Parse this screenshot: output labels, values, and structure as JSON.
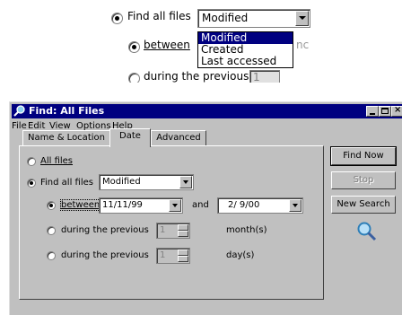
{
  "inset": {
    "find_all_files_label": "Find all files",
    "combo_value": "Modified",
    "options": [
      "Modified",
      "Created",
      "Last accessed"
    ],
    "between_label": "between",
    "between_trailing": "nc",
    "during_label": "during the previous",
    "during_value": "1"
  },
  "window": {
    "title": "Find: All Files",
    "menu": [
      "File",
      "Edit",
      "View",
      "Options",
      "Help"
    ],
    "tabs": [
      "Name & Location",
      "Date",
      "Advanced"
    ],
    "all_files_label": "All files",
    "find_all_files_label": "Find all files",
    "find_all_files_value": "Modified",
    "between_label": "between",
    "between_from": "11/11/99",
    "and_label": "and",
    "between_to": "2/ 9/00",
    "months_label": "during the previous",
    "months_value": "1",
    "months_unit": "month(s)",
    "days_label": "during the previous",
    "days_value": "1",
    "days_unit": "day(s)",
    "buttons": {
      "find_now": "Find Now",
      "stop": "Stop",
      "new_search": "New Search"
    }
  }
}
